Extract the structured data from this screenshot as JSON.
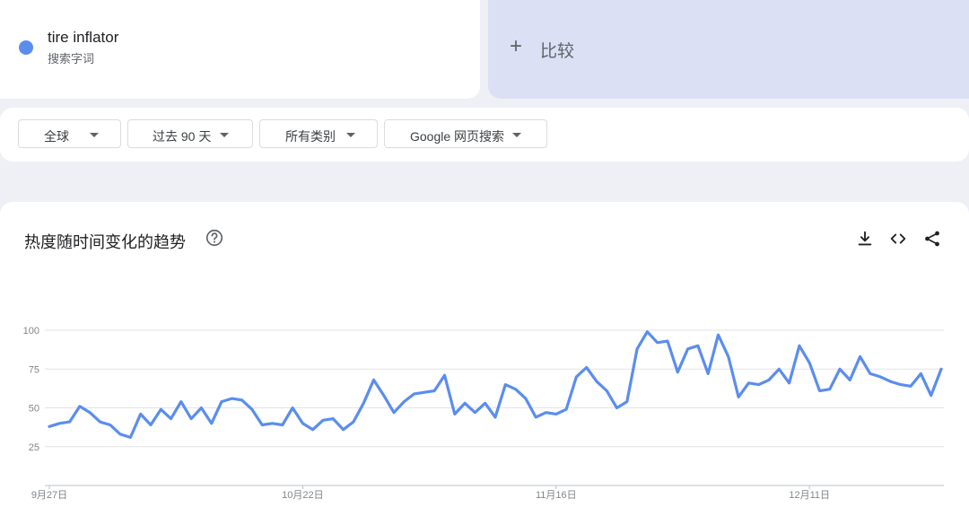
{
  "term": {
    "name": "tire inflator",
    "type": "搜索字词",
    "color": "#5b8def"
  },
  "compare": {
    "label": "比较"
  },
  "filters": {
    "region": "全球",
    "time": "过去 90 天",
    "category": "所有类别",
    "search_type": "Google 网页搜索"
  },
  "chart": {
    "title": "热度随时间变化的趋势",
    "icons": [
      "help-icon",
      "download-icon",
      "embed-icon",
      "share-icon"
    ]
  },
  "chart_data": {
    "type": "line",
    "title": "热度随时间变化的趋势",
    "xlabel": "",
    "ylabel": "",
    "ylim": [
      0,
      100
    ],
    "yticks": [
      25,
      50,
      75,
      100
    ],
    "xtick_labels": [
      {
        "label": "9月27日",
        "index": 0
      },
      {
        "label": "10月22日",
        "index": 25
      },
      {
        "label": "11月16日",
        "index": 50
      },
      {
        "label": "12月11日",
        "index": 75
      }
    ],
    "grid": true,
    "color": "#5b8def",
    "series": [
      {
        "values": [
          38,
          40,
          41,
          51,
          47,
          41,
          39,
          33,
          31,
          46,
          39,
          49,
          43,
          54,
          43,
          50,
          40,
          54,
          56,
          55,
          49,
          39,
          40,
          39,
          50,
          40,
          36,
          42,
          43,
          36,
          41,
          53,
          68,
          58,
          47,
          54,
          59,
          60,
          61,
          71,
          46,
          53,
          47,
          53,
          44,
          65,
          62,
          56,
          44,
          47,
          46,
          49,
          70,
          76,
          67,
          61,
          50,
          54,
          88,
          99,
          92,
          93,
          73,
          88,
          90,
          72,
          97,
          83,
          57,
          66,
          65,
          68,
          75,
          66,
          90,
          79,
          61,
          62,
          75,
          68,
          83,
          72,
          70,
          67,
          65,
          64,
          72,
          58,
          75
        ]
      }
    ]
  }
}
